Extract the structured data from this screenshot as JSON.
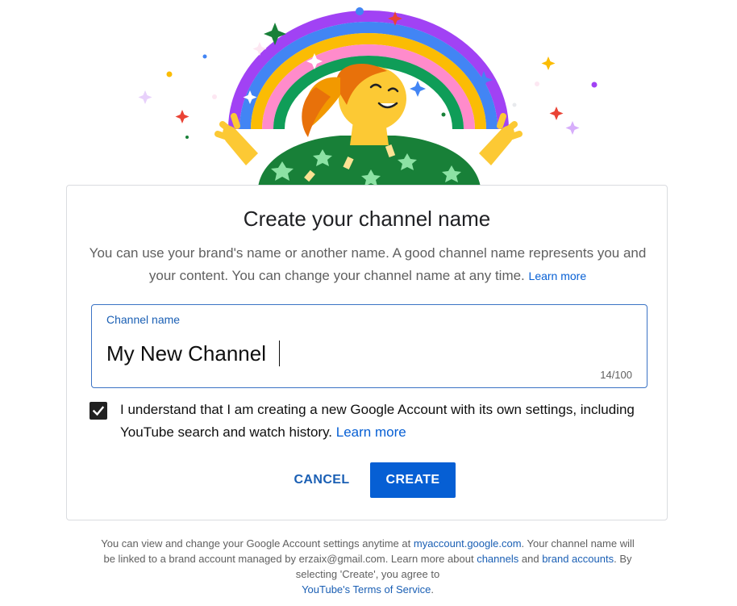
{
  "dialog": {
    "title": "Create your channel name",
    "subtitle": "You can use your brand's name or another name. A good channel name represents you and your content. You can change your channel name at any time.",
    "subtitle_learn_more": "Learn more"
  },
  "channel_field": {
    "label": "Channel name",
    "value": "My New Channel",
    "counter": "14/100"
  },
  "consent": {
    "checked": true,
    "text": "I understand that I am creating a new Google Account with its own settings, including YouTube search and watch history.",
    "learn_more": "Learn more"
  },
  "actions": {
    "cancel_label": "CANCEL",
    "create_label": "CREATE"
  },
  "footer": {
    "part1": "You can view and change your Google Account settings anytime at",
    "account_link": "myaccount.google.com",
    "part2": ". Your channel name will be linked to a brand account managed by erzaix@gmail.com. Learn more about",
    "channels_link": "channels",
    "part3": "and",
    "brand_accounts_link": "brand accounts",
    "part4": ". By selecting 'Create', you agree to",
    "tos_link": "YouTube's Terms of Service",
    "part5": "."
  },
  "colors": {
    "accent": "#065fd4",
    "field_border": "#3b73c5",
    "muted_text": "#606060"
  },
  "icons": {
    "illustration": "rainbow-celebration-illustration",
    "checkbox": "checkmark-icon"
  }
}
